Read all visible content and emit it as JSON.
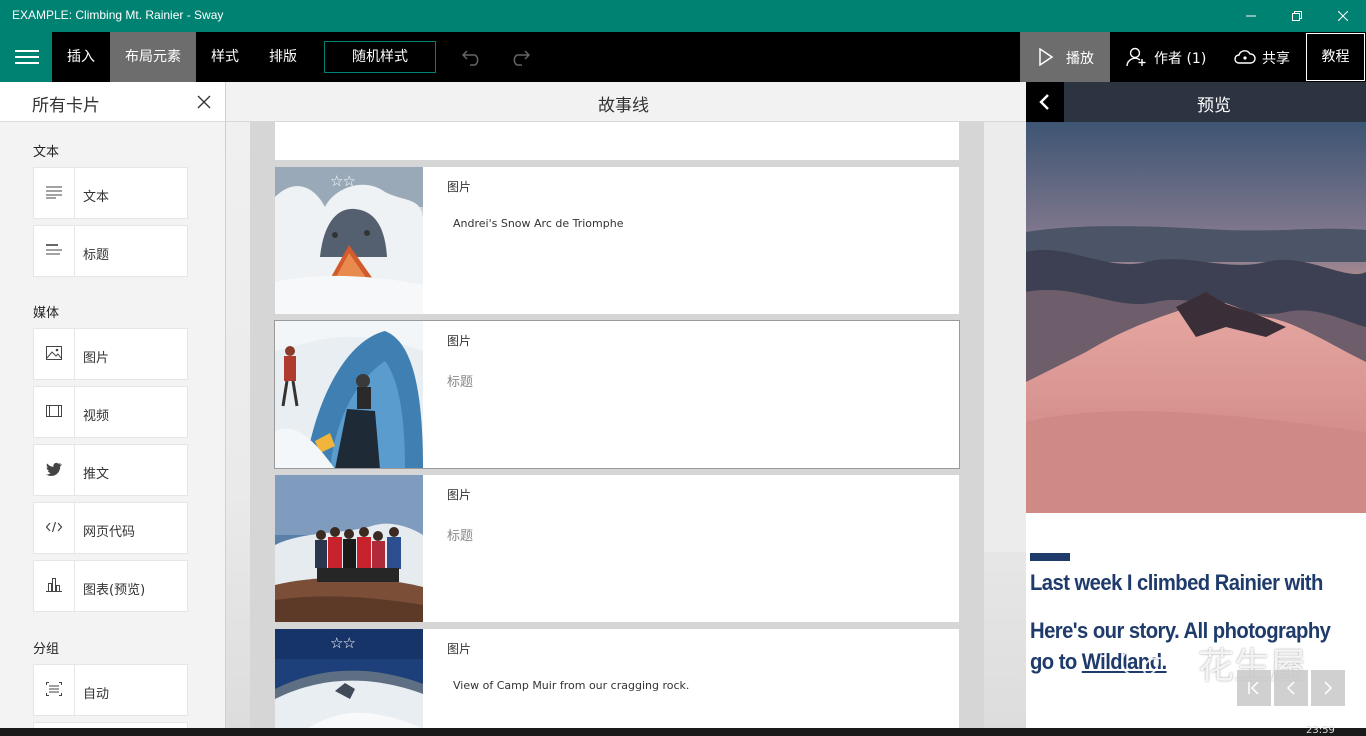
{
  "window": {
    "title": "EXAMPLE: Climbing Mt. Rainier - Sway"
  },
  "toolbar": {
    "items": [
      {
        "label": "插入"
      },
      {
        "label": "布局元素"
      },
      {
        "label": "样式"
      },
      {
        "label": "排版"
      }
    ],
    "random_style": "随机样式",
    "play": "播放",
    "author": "作者 (1)",
    "share": "共享",
    "tutorial": "教程"
  },
  "left_panel": {
    "title": "所有卡片",
    "sections": {
      "text": "文本",
      "media": "媒体",
      "group": "分组"
    },
    "cards": {
      "text": "文本",
      "heading": "标题",
      "image": "图片",
      "video": "视频",
      "tweet": "推文",
      "embed": "网页代码",
      "chart": "图表(预览)",
      "auto": "自动"
    }
  },
  "storyline": {
    "title": "故事线",
    "cards": [
      {
        "type": "图片",
        "caption": "Andrei's Snow Arc de Triomphe",
        "stars": "☆☆"
      },
      {
        "type": "图片",
        "caption": "标题"
      },
      {
        "type": "图片",
        "caption": "标题"
      },
      {
        "type": "图片",
        "caption": "View of Camp Muir from our cragging rock.",
        "stars": "☆☆"
      }
    ]
  },
  "preview": {
    "title": "预览",
    "line1": "Last week I climbed Rainier with",
    "line2": "Here's our story. All photography",
    "line3_prefix": "go to ",
    "line3_link": "Wildland.",
    "watermark": "花生屋"
  },
  "taskbar": {
    "clock": "23:59"
  },
  "colors": {
    "accent": "#008272",
    "toolbar_bg": "#000000",
    "active_tab": "#6d6d6d",
    "preview_text": "#1f3b6b"
  }
}
